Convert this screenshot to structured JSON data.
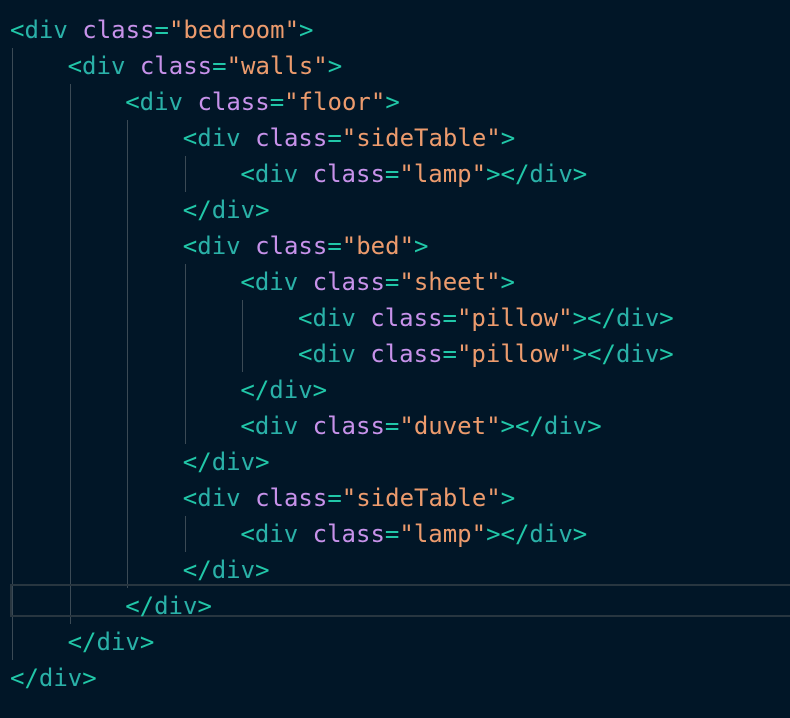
{
  "colors": {
    "background": "#011627",
    "punctuation": "#21c7a8",
    "tag_name": "#2ab1a8",
    "attribute_name": "#c792ea",
    "string": "#ec9b6d",
    "indent_guide": "#3b4a55",
    "current_line_border": "#283640"
  },
  "editor": {
    "active_line": 16,
    "lines": [
      {
        "indent": 0,
        "kind": "open",
        "tag": "div",
        "attr": "class",
        "value": "bedroom"
      },
      {
        "indent": 1,
        "kind": "open",
        "tag": "div",
        "attr": "class",
        "value": "walls"
      },
      {
        "indent": 2,
        "kind": "open",
        "tag": "div",
        "attr": "class",
        "value": "floor"
      },
      {
        "indent": 3,
        "kind": "open",
        "tag": "div",
        "attr": "class",
        "value": "sideTable"
      },
      {
        "indent": 4,
        "kind": "selfclose",
        "tag": "div",
        "attr": "class",
        "value": "lamp"
      },
      {
        "indent": 3,
        "kind": "close",
        "tag": "div"
      },
      {
        "indent": 3,
        "kind": "open",
        "tag": "div",
        "attr": "class",
        "value": "bed"
      },
      {
        "indent": 4,
        "kind": "open",
        "tag": "div",
        "attr": "class",
        "value": "sheet"
      },
      {
        "indent": 5,
        "kind": "selfclose",
        "tag": "div",
        "attr": "class",
        "value": "pillow"
      },
      {
        "indent": 5,
        "kind": "selfclose",
        "tag": "div",
        "attr": "class",
        "value": "pillow"
      },
      {
        "indent": 4,
        "kind": "close",
        "tag": "div"
      },
      {
        "indent": 4,
        "kind": "selfclose",
        "tag": "div",
        "attr": "class",
        "value": "duvet"
      },
      {
        "indent": 3,
        "kind": "close",
        "tag": "div"
      },
      {
        "indent": 3,
        "kind": "open",
        "tag": "div",
        "attr": "class",
        "value": "sideTable"
      },
      {
        "indent": 4,
        "kind": "selfclose",
        "tag": "div",
        "attr": "class",
        "value": "lamp"
      },
      {
        "indent": 3,
        "kind": "close",
        "tag": "div"
      },
      {
        "indent": 2,
        "kind": "close",
        "tag": "div"
      },
      {
        "indent": 1,
        "kind": "close",
        "tag": "div"
      },
      {
        "indent": 0,
        "kind": "close",
        "tag": "div"
      }
    ]
  }
}
